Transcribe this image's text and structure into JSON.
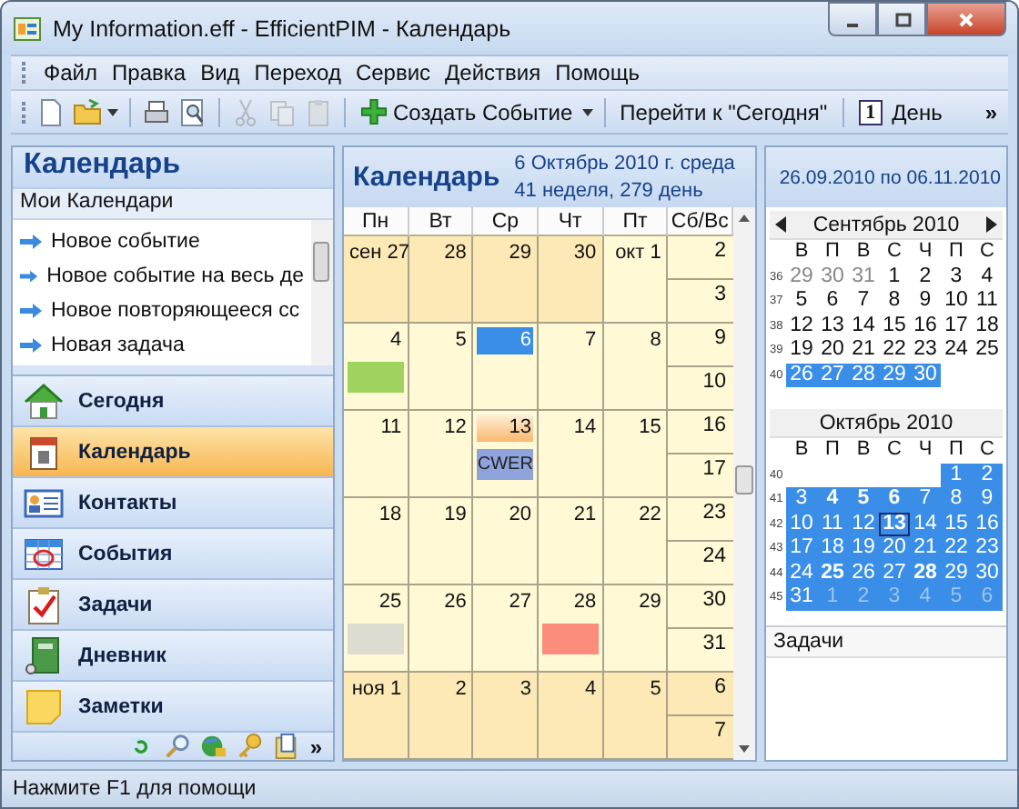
{
  "window": {
    "title": "My Information.eff - EfficientPIM - Календарь"
  },
  "menu": [
    "Файл",
    "Правка",
    "Вид",
    "Переход",
    "Сервис",
    "Действия",
    "Помощь"
  ],
  "toolbar": {
    "new_event": "Создать Событие",
    "go_today": "Перейти к \"Сегодня\"",
    "day_glyph": "1",
    "day": "День",
    "more": "»"
  },
  "sidebar": {
    "title": "Календарь",
    "section": "Мои Календари",
    "actions": [
      "Новое событие",
      "Новое событие на весь де",
      "Новое повторяющееся сс",
      "Новая задача"
    ],
    "nav": [
      {
        "kind": "house",
        "label": "Сегодня",
        "selected": false
      },
      {
        "kind": "calendar",
        "label": "Календарь",
        "selected": true
      },
      {
        "kind": "contacts",
        "label": "Контакты",
        "selected": false
      },
      {
        "kind": "events",
        "label": "События",
        "selected": false
      },
      {
        "kind": "tasks",
        "label": "Задачи",
        "selected": false
      },
      {
        "kind": "journal",
        "label": "Дневник",
        "selected": false
      },
      {
        "kind": "notes",
        "label": "Заметки",
        "selected": false
      }
    ],
    "more": "»"
  },
  "calendar": {
    "title": "Календарь",
    "date_line": "6 Октябрь 2010 г. среда",
    "week_line": "41 неделя, 279 день",
    "range": "26.09.2010 по 06.11.2010",
    "weekdays": [
      "Пн",
      "Вт",
      "Ср",
      "Чт",
      "Пт",
      "Сб/Вс"
    ],
    "weeks": [
      {
        "days": [
          {
            "label": "сен 27",
            "in_month": false,
            "today": false,
            "selected": false
          },
          {
            "label": "28",
            "in_month": false,
            "today": false,
            "selected": false
          },
          {
            "label": "29",
            "in_month": false,
            "today": false,
            "selected": false
          },
          {
            "label": "30",
            "in_month": false,
            "today": false,
            "selected": false
          },
          {
            "label": "окт 1",
            "in_month": true,
            "today": false,
            "selected": false
          }
        ],
        "weekend": [
          {
            "label": "2",
            "in_month": true
          },
          {
            "label": "3",
            "in_month": true
          }
        ]
      },
      {
        "days": [
          {
            "label": "4",
            "in_month": true,
            "today": false,
            "selected": false,
            "events": [
              {
                "color": "#9fd35f"
              }
            ]
          },
          {
            "label": "5",
            "in_month": true,
            "today": false,
            "selected": false
          },
          {
            "label": "6",
            "in_month": true,
            "today": true,
            "selected": false
          },
          {
            "label": "7",
            "in_month": true,
            "today": false,
            "selected": false
          },
          {
            "label": "8",
            "in_month": true,
            "today": false,
            "selected": false
          }
        ],
        "weekend": [
          {
            "label": "9",
            "in_month": true
          },
          {
            "label": "10",
            "in_month": true
          }
        ]
      },
      {
        "days": [
          {
            "label": "11",
            "in_month": true,
            "today": false,
            "selected": false
          },
          {
            "label": "12",
            "in_month": true,
            "today": false,
            "selected": false
          },
          {
            "label": "13",
            "in_month": true,
            "today": false,
            "selected": true,
            "events": [
              {
                "color": "#8fa3dd",
                "text": "CWER"
              }
            ]
          },
          {
            "label": "14",
            "in_month": true,
            "today": false,
            "selected": false
          },
          {
            "label": "15",
            "in_month": true,
            "today": false,
            "selected": false
          }
        ],
        "weekend": [
          {
            "label": "16",
            "in_month": true
          },
          {
            "label": "17",
            "in_month": true
          }
        ]
      },
      {
        "days": [
          {
            "label": "18",
            "in_month": true,
            "today": false,
            "selected": false
          },
          {
            "label": "19",
            "in_month": true,
            "today": false,
            "selected": false
          },
          {
            "label": "20",
            "in_month": true,
            "today": false,
            "selected": false
          },
          {
            "label": "21",
            "in_month": true,
            "today": false,
            "selected": false
          },
          {
            "label": "22",
            "in_month": true,
            "today": false,
            "selected": false
          }
        ],
        "weekend": [
          {
            "label": "23",
            "in_month": true
          },
          {
            "label": "24",
            "in_month": true
          }
        ]
      },
      {
        "days": [
          {
            "label": "25",
            "in_month": true,
            "today": false,
            "selected": false,
            "events": [
              {
                "color": "#dcddd0"
              }
            ]
          },
          {
            "label": "26",
            "in_month": true,
            "today": false,
            "selected": false
          },
          {
            "label": "27",
            "in_month": true,
            "today": false,
            "selected": false
          },
          {
            "label": "28",
            "in_month": true,
            "today": false,
            "selected": false,
            "events": [
              {
                "color": "#fc8c7c"
              }
            ]
          },
          {
            "label": "29",
            "in_month": true,
            "today": false,
            "selected": false
          }
        ],
        "weekend": [
          {
            "label": "30",
            "in_month": true
          },
          {
            "label": "31",
            "in_month": true
          }
        ]
      },
      {
        "days": [
          {
            "label": "ноя 1",
            "in_month": false,
            "today": false,
            "selected": false
          },
          {
            "label": "2",
            "in_month": false,
            "today": false,
            "selected": false
          },
          {
            "label": "3",
            "in_month": false,
            "today": false,
            "selected": false
          },
          {
            "label": "4",
            "in_month": false,
            "today": false,
            "selected": false
          },
          {
            "label": "5",
            "in_month": false,
            "today": false,
            "selected": false
          }
        ],
        "weekend": [
          {
            "label": "6",
            "in_month": false
          },
          {
            "label": "7",
            "in_month": false
          }
        ]
      }
    ]
  },
  "mini_calendars": [
    {
      "title": "Сентябрь 2010",
      "nav_arrows": true,
      "weekdays": [
        "В",
        "П",
        "В",
        "С",
        "Ч",
        "П",
        "С"
      ],
      "weeks": [
        {
          "number": "36",
          "days": [
            {
              "label": "29",
              "other": true,
              "selected": false,
              "bold": false,
              "current": false
            },
            {
              "label": "30",
              "other": true,
              "selected": false,
              "bold": false,
              "current": false
            },
            {
              "label": "31",
              "other": true,
              "selected": false,
              "bold": false,
              "current": false
            },
            {
              "label": "1",
              "other": false,
              "selected": false,
              "bold": false,
              "current": false
            },
            {
              "label": "2",
              "other": false,
              "selected": false,
              "bold": false,
              "current": false
            },
            {
              "label": "3",
              "other": false,
              "selected": false,
              "bold": false,
              "current": false
            },
            {
              "label": "4",
              "other": false,
              "selected": false,
              "bold": false,
              "current": false
            }
          ]
        },
        {
          "number": "37",
          "days": [
            {
              "label": "5",
              "other": false,
              "selected": false,
              "bold": false,
              "current": false
            },
            {
              "label": "6",
              "other": false,
              "selected": false,
              "bold": false,
              "current": false
            },
            {
              "label": "7",
              "other": false,
              "selected": false,
              "bold": false,
              "current": false
            },
            {
              "label": "8",
              "other": false,
              "selected": false,
              "bold": false,
              "current": false
            },
            {
              "label": "9",
              "other": false,
              "selected": false,
              "bold": false,
              "current": false
            },
            {
              "label": "10",
              "other": false,
              "selected": false,
              "bold": false,
              "current": false
            },
            {
              "label": "11",
              "other": false,
              "selected": false,
              "bold": false,
              "current": false
            }
          ]
        },
        {
          "number": "38",
          "days": [
            {
              "label": "12",
              "other": false,
              "selected": false,
              "bold": false,
              "current": false
            },
            {
              "label": "13",
              "other": false,
              "selected": false,
              "bold": false,
              "current": false
            },
            {
              "label": "14",
              "other": false,
              "selected": false,
              "bold": false,
              "current": false
            },
            {
              "label": "15",
              "other": false,
              "selected": false,
              "bold": false,
              "current": false
            },
            {
              "label": "16",
              "other": false,
              "selected": false,
              "bold": false,
              "current": false
            },
            {
              "label": "17",
              "other": false,
              "selected": false,
              "bold": false,
              "current": false
            },
            {
              "label": "18",
              "other": false,
              "selected": false,
              "bold": false,
              "current": false
            }
          ]
        },
        {
          "number": "39",
          "days": [
            {
              "label": "19",
              "other": false,
              "selected": false,
              "bold": false,
              "current": false
            },
            {
              "label": "20",
              "other": false,
              "selected": false,
              "bold": false,
              "current": false
            },
            {
              "label": "21",
              "other": false,
              "selected": false,
              "bold": false,
              "current": false
            },
            {
              "label": "22",
              "other": false,
              "selected": false,
              "bold": false,
              "current": false
            },
            {
              "label": "23",
              "other": false,
              "selected": false,
              "bold": false,
              "current": false
            },
            {
              "label": "24",
              "other": false,
              "selected": false,
              "bold": false,
              "current": false
            },
            {
              "label": "25",
              "other": false,
              "selected": false,
              "bold": false,
              "current": false
            }
          ]
        },
        {
          "number": "40",
          "kind": "month_end",
          "days": [
            {
              "label": "26",
              "other": false,
              "selected": true,
              "bold": false,
              "current": false
            },
            {
              "label": "27",
              "other": false,
              "selected": true,
              "bold": false,
              "current": false
            },
            {
              "label": "28",
              "other": false,
              "selected": true,
              "bold": false,
              "current": false
            },
            {
              "label": "29",
              "other": false,
              "selected": true,
              "bold": false,
              "current": false
            },
            {
              "label": "30",
              "other": false,
              "selected": true,
              "bold": false,
              "current": false
            }
          ]
        }
      ]
    },
    {
      "title": "Октябрь 2010",
      "nav_arrows": false,
      "weekdays": [
        "В",
        "П",
        "В",
        "С",
        "Ч",
        "П",
        "С"
      ],
      "weeks": [
        {
          "number": "40",
          "kind": "month_start",
          "days": [
            {
              "label": "1",
              "other": false,
              "selected": true,
              "bold": false,
              "current": false
            },
            {
              "label": "2",
              "other": false,
              "selected": true,
              "bold": false,
              "current": false
            }
          ]
        },
        {
          "number": "41",
          "days": [
            {
              "label": "3",
              "other": false,
              "selected": true,
              "bold": false,
              "current": false
            },
            {
              "label": "4",
              "other": false,
              "selected": true,
              "bold": true,
              "current": false
            },
            {
              "label": "5",
              "other": false,
              "selected": true,
              "bold": true,
              "current": false
            },
            {
              "label": "6",
              "other": false,
              "selected": true,
              "bold": true,
              "current": false
            },
            {
              "label": "7",
              "other": false,
              "selected": true,
              "bold": false,
              "current": false
            },
            {
              "label": "8",
              "other": false,
              "selected": true,
              "bold": false,
              "current": false
            },
            {
              "label": "9",
              "other": false,
              "selected": true,
              "bold": false,
              "current": false
            }
          ]
        },
        {
          "number": "42",
          "days": [
            {
              "label": "10",
              "other": false,
              "selected": true,
              "bold": false,
              "current": false
            },
            {
              "label": "11",
              "other": false,
              "selected": true,
              "bold": false,
              "current": false
            },
            {
              "label": "12",
              "other": false,
              "selected": true,
              "bold": false,
              "current": false
            },
            {
              "label": "13",
              "other": false,
              "selected": true,
              "bold": true,
              "current": true
            },
            {
              "label": "14",
              "other": false,
              "selected": true,
              "bold": false,
              "current": false
            },
            {
              "label": "15",
              "other": false,
              "selected": true,
              "bold": false,
              "current": false
            },
            {
              "label": "16",
              "other": false,
              "selected": true,
              "bold": false,
              "current": false
            }
          ]
        },
        {
          "number": "43",
          "days": [
            {
              "label": "17",
              "other": false,
              "selected": true,
              "bold": false,
              "current": false
            },
            {
              "label": "18",
              "other": false,
              "selected": true,
              "bold": false,
              "current": false
            },
            {
              "label": "19",
              "other": false,
              "selected": true,
              "bold": false,
              "current": false
            },
            {
              "label": "20",
              "other": false,
              "selected": true,
              "bold": false,
              "current": false
            },
            {
              "label": "21",
              "other": false,
              "selected": true,
              "bold": false,
              "current": false
            },
            {
              "label": "22",
              "other": false,
              "selected": true,
              "bold": false,
              "current": false
            },
            {
              "label": "23",
              "other": false,
              "selected": true,
              "bold": false,
              "current": false
            }
          ]
        },
        {
          "number": "44",
          "days": [
            {
              "label": "24",
              "other": false,
              "selected": true,
              "bold": false,
              "current": false
            },
            {
              "label": "25",
              "other": false,
              "selected": true,
              "bold": true,
              "current": false
            },
            {
              "label": "26",
              "other": false,
              "selected": true,
              "bold": false,
              "current": false
            },
            {
              "label": "27",
              "other": false,
              "selected": true,
              "bold": false,
              "current": false
            },
            {
              "label": "28",
              "other": false,
              "selected": true,
              "bold": true,
              "current": false
            },
            {
              "label": "29",
              "other": false,
              "selected": true,
              "bold": false,
              "current": false
            },
            {
              "label": "30",
              "other": false,
              "selected": true,
              "bold": false,
              "current": false
            }
          ]
        },
        {
          "number": "45",
          "days": [
            {
              "label": "31",
              "other": false,
              "selected": true,
              "bold": false,
              "current": false
            },
            {
              "label": "1",
              "other": true,
              "selected": true,
              "bold": false,
              "current": false
            },
            {
              "label": "2",
              "other": true,
              "selected": true,
              "bold": false,
              "current": false
            },
            {
              "label": "3",
              "other": true,
              "selected": true,
              "bold": false,
              "current": false
            },
            {
              "label": "4",
              "other": true,
              "selected": true,
              "bold": false,
              "current": false
            },
            {
              "label": "5",
              "other": true,
              "selected": true,
              "bold": false,
              "current": false
            },
            {
              "label": "6",
              "other": true,
              "selected": true,
              "bold": false,
              "current": false
            }
          ]
        }
      ]
    }
  ],
  "tasks": {
    "title": "Задачи"
  },
  "status_bar": "Нажмите F1 для помощи"
}
